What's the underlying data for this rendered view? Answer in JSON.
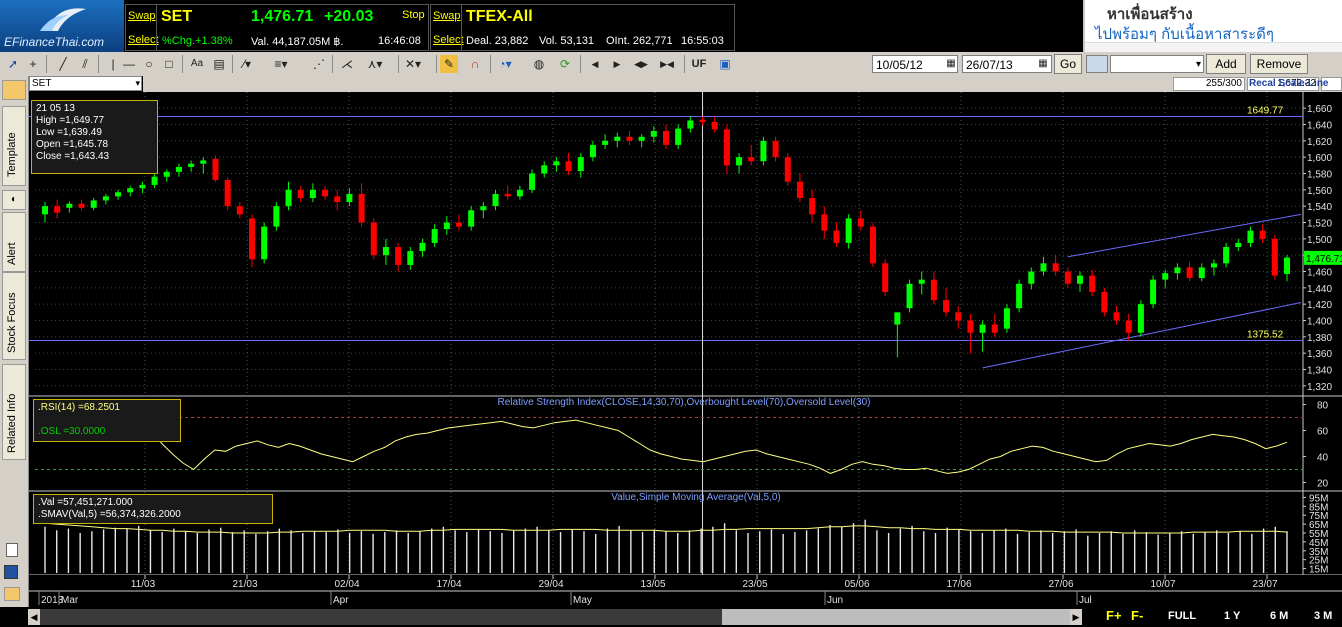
{
  "logo": {
    "text": "EFinanceThai.com"
  },
  "ticker_set": {
    "swap": "Swap",
    "select": "Select",
    "name": "SET",
    "price": "1,476.71",
    "change": "+20.03",
    "stop": "Stop",
    "pct": "%Chg.+1.38%",
    "val": "Val. 44,187.05M ฿.",
    "time": "16:46:08"
  },
  "ticker_tfex": {
    "swap": "Swap",
    "select": "Select",
    "name": "TFEX-All",
    "deal": "Deal. 23,882",
    "vol": "Vol. 53,131",
    "oint": "OInt. 262,771",
    "time": "16:55:03"
  },
  "ad": {
    "line1": "หาเพื่อนสร้าง",
    "line2": "ไปพร้อมๆ กับเนื้อหาสาระดีๆ"
  },
  "toolbar": {
    "uf": "UF",
    "date_from": "10/05/12",
    "date_to": "26/07/13",
    "go": "Go",
    "add": "Add",
    "remove": "Remove"
  },
  "symbol_select": "SET",
  "status": {
    "count": "255/300",
    "value": "1,672.32",
    "recal": "Recal Scale-Line"
  },
  "side_tabs": [
    "Template",
    "Alert",
    "Stock Focus",
    "Related Info"
  ],
  "ohlc_box": {
    "date": "21 05 13",
    "high": "High  =1,649.77",
    "low": "Low   =1,639.49",
    "open": "Open  =1,645.78",
    "close": "Close  =1,643.43"
  },
  "rsi_box": {
    "rsi": ".RSI(14)    =68.2501",
    "osl": ".OSL    =30.0000"
  },
  "val_box": {
    "val": ".Val    =57,451,271.000",
    "smav": ".SMAV(Val,5)    =56,374,326.2000"
  },
  "price_labels": {
    "resistance": "1649.77",
    "support": "1375.52",
    "last": "1,476.71"
  },
  "bottom_nav": [
    "F+",
    "F-",
    "FULL",
    "1 Y",
    "6 M",
    "3 M"
  ],
  "colors": {
    "up": "#00ff00",
    "down": "#ff0000",
    "line": "#6b6bff",
    "indicator": "#ffff80",
    "bg": "#000000"
  },
  "chart_data": [
    {
      "type": "candlestick",
      "title": "",
      "ylim": [
        1310,
        1670
      ],
      "y_ticks": [
        "1,660",
        "1,640",
        "1,620",
        "1,600",
        "1,580",
        "1,560",
        "1,540",
        "1,520",
        "1,500",
        "1,480",
        "1,460",
        "1,440",
        "1,420",
        "1,400",
        "1,380",
        "1,360",
        "1,340",
        "1,320"
      ],
      "x_ticks": [
        "11/03",
        "21/03",
        "02/04",
        "17/04",
        "29/04",
        "13/05",
        "23/05",
        "05/06",
        "17/06",
        "27/06",
        "10/07",
        "23/07"
      ],
      "x_months": [
        "2013",
        "Mar",
        "Apr",
        "May",
        "Jun",
        "Jul"
      ],
      "candles": [
        [
          1530,
          1545,
          1520,
          1540
        ],
        [
          1540,
          1548,
          1525,
          1532
        ],
        [
          1538,
          1546,
          1532,
          1543
        ],
        [
          1543,
          1548,
          1535,
          1538
        ],
        [
          1538,
          1550,
          1535,
          1547
        ],
        [
          1547,
          1555,
          1542,
          1552
        ],
        [
          1552,
          1560,
          1548,
          1557
        ],
        [
          1557,
          1565,
          1552,
          1562
        ],
        [
          1562,
          1570,
          1556,
          1566
        ],
        [
          1566,
          1580,
          1562,
          1576
        ],
        [
          1576,
          1585,
          1570,
          1582
        ],
        [
          1582,
          1592,
          1576,
          1588
        ],
        [
          1588,
          1596,
          1582,
          1592
        ],
        [
          1592,
          1600,
          1580,
          1596
        ],
        [
          1598,
          1602,
          1570,
          1572
        ],
        [
          1572,
          1575,
          1535,
          1540
        ],
        [
          1540,
          1545,
          1525,
          1530
        ],
        [
          1525,
          1530,
          1465,
          1475
        ],
        [
          1475,
          1520,
          1470,
          1515
        ],
        [
          1515,
          1545,
          1510,
          1540
        ],
        [
          1540,
          1570,
          1535,
          1560
        ],
        [
          1560,
          1565,
          1545,
          1550
        ],
        [
          1550,
          1568,
          1545,
          1560
        ],
        [
          1560,
          1565,
          1548,
          1552
        ],
        [
          1552,
          1560,
          1535,
          1545
        ],
        [
          1545,
          1562,
          1540,
          1555
        ],
        [
          1555,
          1568,
          1515,
          1520
        ],
        [
          1520,
          1525,
          1475,
          1480
        ],
        [
          1480,
          1500,
          1468,
          1490
        ],
        [
          1490,
          1495,
          1460,
          1468
        ],
        [
          1468,
          1490,
          1462,
          1485
        ],
        [
          1485,
          1500,
          1478,
          1495
        ],
        [
          1495,
          1518,
          1490,
          1512
        ],
        [
          1512,
          1528,
          1505,
          1520
        ],
        [
          1520,
          1530,
          1510,
          1515
        ],
        [
          1515,
          1540,
          1510,
          1535
        ],
        [
          1535,
          1545,
          1525,
          1540
        ],
        [
          1540,
          1560,
          1535,
          1555
        ],
        [
          1555,
          1565,
          1548,
          1552
        ],
        [
          1552,
          1565,
          1548,
          1560
        ],
        [
          1560,
          1585,
          1556,
          1580
        ],
        [
          1580,
          1595,
          1575,
          1590
        ],
        [
          1590,
          1600,
          1582,
          1595
        ],
        [
          1595,
          1605,
          1578,
          1583
        ],
        [
          1583,
          1605,
          1575,
          1600
        ],
        [
          1600,
          1620,
          1595,
          1615
        ],
        [
          1615,
          1628,
          1610,
          1620
        ],
        [
          1620,
          1630,
          1612,
          1625
        ],
        [
          1625,
          1632,
          1615,
          1620
        ],
        [
          1620,
          1628,
          1612,
          1625
        ],
        [
          1625,
          1638,
          1618,
          1632
        ],
        [
          1632,
          1640,
          1610,
          1615
        ],
        [
          1615,
          1640,
          1610,
          1635
        ],
        [
          1635,
          1650,
          1630,
          1645
        ],
        [
          1646,
          1650,
          1639,
          1643
        ],
        [
          1643,
          1650,
          1630,
          1634
        ],
        [
          1634,
          1640,
          1580,
          1590
        ],
        [
          1590,
          1605,
          1580,
          1600
        ],
        [
          1600,
          1615,
          1590,
          1595
        ],
        [
          1595,
          1625,
          1590,
          1620
        ],
        [
          1620,
          1625,
          1595,
          1600
        ],
        [
          1600,
          1605,
          1565,
          1570
        ],
        [
          1570,
          1580,
          1545,
          1550
        ],
        [
          1550,
          1560,
          1520,
          1530
        ],
        [
          1530,
          1540,
          1500,
          1510
        ],
        [
          1510,
          1520,
          1490,
          1495
        ],
        [
          1495,
          1530,
          1488,
          1525
        ],
        [
          1525,
          1535,
          1510,
          1515
        ],
        [
          1515,
          1520,
          1465,
          1470
        ],
        [
          1470,
          1475,
          1430,
          1435
        ],
        [
          1395,
          1405,
          1355,
          1410
        ],
        [
          1415,
          1450,
          1410,
          1445
        ],
        [
          1445,
          1460,
          1432,
          1450
        ],
        [
          1450,
          1460,
          1420,
          1425
        ],
        [
          1425,
          1440,
          1405,
          1410
        ],
        [
          1410,
          1418,
          1390,
          1400
        ],
        [
          1400,
          1408,
          1360,
          1385
        ],
        [
          1385,
          1400,
          1362,
          1395
        ],
        [
          1395,
          1408,
          1380,
          1385
        ],
        [
          1390,
          1420,
          1385,
          1415
        ],
        [
          1415,
          1450,
          1410,
          1445
        ],
        [
          1445,
          1465,
          1438,
          1460
        ],
        [
          1460,
          1478,
          1455,
          1470
        ],
        [
          1470,
          1480,
          1455,
          1460
        ],
        [
          1460,
          1465,
          1440,
          1445
        ],
        [
          1445,
          1460,
          1435,
          1455
        ],
        [
          1455,
          1462,
          1430,
          1435
        ],
        [
          1435,
          1440,
          1405,
          1410
        ],
        [
          1410,
          1418,
          1395,
          1400
        ],
        [
          1400,
          1408,
          1375,
          1385
        ],
        [
          1385,
          1425,
          1380,
          1420
        ],
        [
          1420,
          1455,
          1415,
          1450
        ],
        [
          1450,
          1462,
          1440,
          1458
        ],
        [
          1458,
          1470,
          1450,
          1465
        ],
        [
          1465,
          1472,
          1448,
          1452
        ],
        [
          1452,
          1470,
          1448,
          1465
        ],
        [
          1465,
          1475,
          1455,
          1470
        ],
        [
          1470,
          1495,
          1465,
          1490
        ],
        [
          1490,
          1500,
          1485,
          1495
        ],
        [
          1495,
          1515,
          1490,
          1510
        ],
        [
          1510,
          1518,
          1495,
          1500
        ],
        [
          1500,
          1505,
          1450,
          1455
        ],
        [
          1457,
          1480,
          1448,
          1477
        ]
      ]
    },
    {
      "type": "line",
      "title": "Relative Strength Index(CLOSE,14,30,70),Overbought Level(70),Oversold Level(30)",
      "ylim": [
        15,
        85
      ],
      "y_ticks": [
        "80",
        "60",
        "40",
        "20"
      ],
      "levels": [
        70,
        30
      ],
      "values": [
        55,
        56,
        58,
        60,
        63,
        66,
        68,
        71,
        72,
        68,
        60,
        50,
        42,
        35,
        30,
        38,
        45,
        44,
        48,
        50,
        52,
        49,
        47,
        50,
        48,
        45,
        42,
        40,
        38,
        36,
        40,
        44,
        47,
        52,
        55,
        57,
        58,
        60,
        62,
        63,
        64,
        65,
        66,
        67,
        65,
        63,
        62,
        64,
        66,
        67,
        68,
        66,
        64,
        62,
        60,
        55,
        50,
        45,
        42,
        40,
        38,
        37,
        36,
        38,
        40,
        42,
        44,
        45,
        42,
        40,
        38,
        36,
        34,
        31,
        27,
        30,
        34,
        36,
        34,
        33,
        31,
        30,
        30,
        31,
        29,
        27,
        28,
        30,
        34,
        38,
        40,
        44,
        46,
        48,
        47,
        44,
        42,
        40,
        38,
        36,
        37,
        42,
        46,
        48,
        50,
        49,
        48,
        50,
        53,
        55,
        57,
        56,
        55,
        53,
        50,
        46,
        48,
        51
      ]
    },
    {
      "type": "bar",
      "title": "Value,Simple Moving Average(Val,5,0)",
      "ylim": [
        10,
        100
      ],
      "y_ticks": [
        "95M",
        "85M",
        "75M",
        "65M",
        "55M",
        "45M",
        "35M",
        "25M",
        "15M"
      ],
      "values": [
        62,
        58,
        60,
        55,
        57,
        59,
        61,
        60,
        63,
        58,
        56,
        60,
        57,
        55,
        59,
        61,
        56,
        58,
        54,
        57,
        60,
        58,
        55,
        57,
        56,
        59,
        55,
        57,
        54,
        56,
        58,
        55,
        57,
        60,
        62,
        58,
        56,
        59,
        57,
        55,
        58,
        60,
        62,
        58,
        56,
        59,
        57,
        54,
        60,
        63,
        58,
        56,
        59,
        57,
        55,
        58,
        60,
        62,
        66,
        58,
        55,
        57,
        59,
        54,
        56,
        58,
        60,
        64,
        62,
        66,
        70,
        58,
        55,
        60,
        63,
        57,
        55,
        61,
        59,
        57,
        55,
        58,
        60,
        54,
        56,
        58,
        55,
        57,
        59,
        52,
        55,
        57,
        54,
        58,
        56,
        53,
        55,
        57,
        54,
        56,
        58,
        55,
        57,
        54,
        60,
        62,
        57
      ],
      "sma": [
        66,
        65,
        64,
        63,
        62,
        61,
        60,
        60,
        59,
        58,
        58,
        57,
        57,
        56,
        56,
        56,
        55,
        55,
        55,
        55,
        56,
        56,
        57,
        57,
        57,
        57,
        58,
        58,
        58,
        58,
        57,
        57,
        57,
        58,
        58,
        59,
        59,
        59,
        59,
        59,
        58,
        58,
        58,
        58,
        59,
        59,
        59,
        59,
        58,
        58,
        58,
        58,
        58,
        57,
        57,
        57,
        58,
        58,
        59,
        59,
        60,
        60,
        60,
        60,
        60,
        60,
        61,
        62,
        62,
        63,
        63,
        62,
        61,
        61,
        60,
        60,
        59,
        59,
        59,
        58,
        58,
        58,
        58,
        58,
        57,
        57,
        57,
        56,
        56,
        56,
        56,
        56,
        55,
        55,
        55,
        55,
        55,
        55,
        56,
        56,
        56,
        56,
        57,
        57,
        57,
        57,
        56
      ]
    }
  ]
}
